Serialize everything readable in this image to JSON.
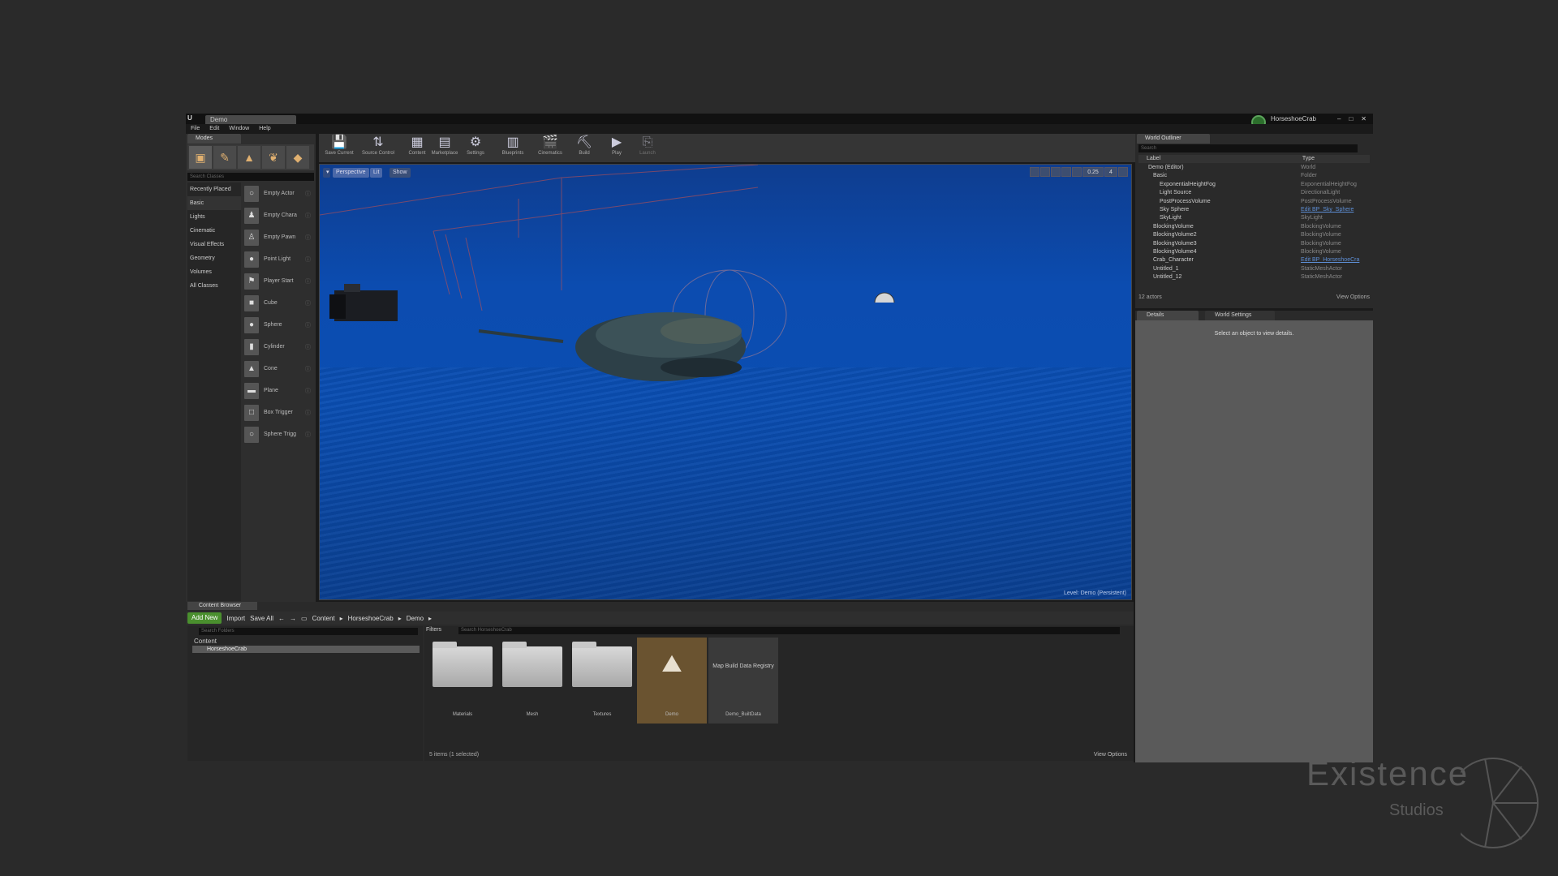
{
  "window": {
    "doc_tab": "Demo",
    "project_name": "HorseshoeCrab",
    "menu": [
      "File",
      "Edit",
      "Window",
      "Help"
    ]
  },
  "modes": {
    "tab": "Modes",
    "search_placeholder": "Search Classes",
    "categories": [
      "Recently Placed",
      "Basic",
      "Lights",
      "Cinematic",
      "Visual Effects",
      "Geometry",
      "Volumes",
      "All Classes"
    ],
    "items": [
      "Empty Actor",
      "Empty Chara",
      "Empty Pawn",
      "Point Light",
      "Player Start",
      "Cube",
      "Sphere",
      "Cylinder",
      "Cone",
      "Plane",
      "Box Trigger",
      "Sphere Trigg"
    ]
  },
  "toolbar": {
    "buttons": [
      "Save Current",
      "Source Control",
      "Content",
      "Marketplace",
      "Settings",
      "Blueprints",
      "Cinematics",
      "Build",
      "Play",
      "Launch"
    ]
  },
  "viewport": {
    "perspective": "Perspective",
    "lit": "Lit",
    "show": "Show",
    "grid_value": "0.25",
    "camera_speed": "4",
    "level_text": "Level: Demo (Persistent)"
  },
  "outliner": {
    "tab": "World Outliner",
    "search_placeholder": "Search",
    "col_label": "Label",
    "col_type": "Type",
    "rows": [
      {
        "label": "Demo (Editor)",
        "type": "World"
      },
      {
        "label": "Basic",
        "type": "Folder"
      },
      {
        "label": "ExponentialHeightFog",
        "type": "ExponentialHeightFog"
      },
      {
        "label": "Light Source",
        "type": "DirectionalLight"
      },
      {
        "label": "PostProcessVolume",
        "type": "PostProcessVolume"
      },
      {
        "label": "Sky Sphere",
        "type": "Edit BP_Sky_Sphere"
      },
      {
        "label": "SkyLight",
        "type": "SkyLight"
      },
      {
        "label": "BlockingVolume",
        "type": "BlockingVolume"
      },
      {
        "label": "BlockingVolume2",
        "type": "BlockingVolume"
      },
      {
        "label": "BlockingVolume3",
        "type": "BlockingVolume"
      },
      {
        "label": "BlockingVolume4",
        "type": "BlockingVolume"
      },
      {
        "label": "Crab_Character",
        "type": "Edit BP_HorseshoeCra"
      },
      {
        "label": "Untitled_1",
        "type": "StaticMeshActor"
      },
      {
        "label": "Untitled_12",
        "type": "StaticMeshActor"
      }
    ],
    "count": "12 actors",
    "view_options": "View Options"
  },
  "details": {
    "tab1": "Details",
    "tab2": "World Settings",
    "message": "Select an object to view details."
  },
  "content_browser": {
    "tab": "Content Browser",
    "add_new": "Add New",
    "import": "Import",
    "save_all": "Save All",
    "path": [
      "Content",
      "HorseshoeCrab",
      "Demo"
    ],
    "folder_search": "Search Folders",
    "tree_root": "Content",
    "tree_child": "HorseshoeCrab",
    "filters": "Filters",
    "asset_search": "Search HorseshoeCrab",
    "assets": [
      "Materials",
      "Mesh",
      "Textures",
      "Demo",
      "Demo_BuiltData"
    ],
    "map_label": "Map Build Data Registry",
    "status": "5 items (1 selected)",
    "view_options": "View Options"
  },
  "watermark": {
    "line1": "Existence",
    "line2": "Studios"
  }
}
